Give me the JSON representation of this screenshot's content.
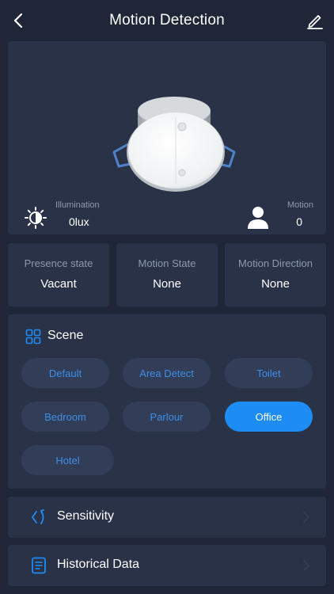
{
  "header": {
    "title": "Motion Detection"
  },
  "device": {
    "illumination_label": "Illumination",
    "illumination_value": "0lux",
    "motion_label": "Motion",
    "motion_value": "0"
  },
  "states": [
    {
      "label": "Presence state",
      "value": "Vacant"
    },
    {
      "label": "Motion State",
      "value": "None"
    },
    {
      "label": "Motion Direction",
      "value": "None"
    }
  ],
  "scene": {
    "title": "Scene",
    "options": [
      "Default",
      "Area Detect",
      "Toilet",
      "Bedroom",
      "Parlour",
      "Office",
      "Hotel"
    ],
    "selected": "Office"
  },
  "menu": {
    "sensitivity_label": "Sensitivity",
    "history_label": "Historical Data"
  },
  "colors": {
    "background": "#1f2638",
    "card": "#2a3248",
    "accent": "#1e8cf5",
    "chip": "#323d58",
    "muted_text": "#8e98ae"
  }
}
